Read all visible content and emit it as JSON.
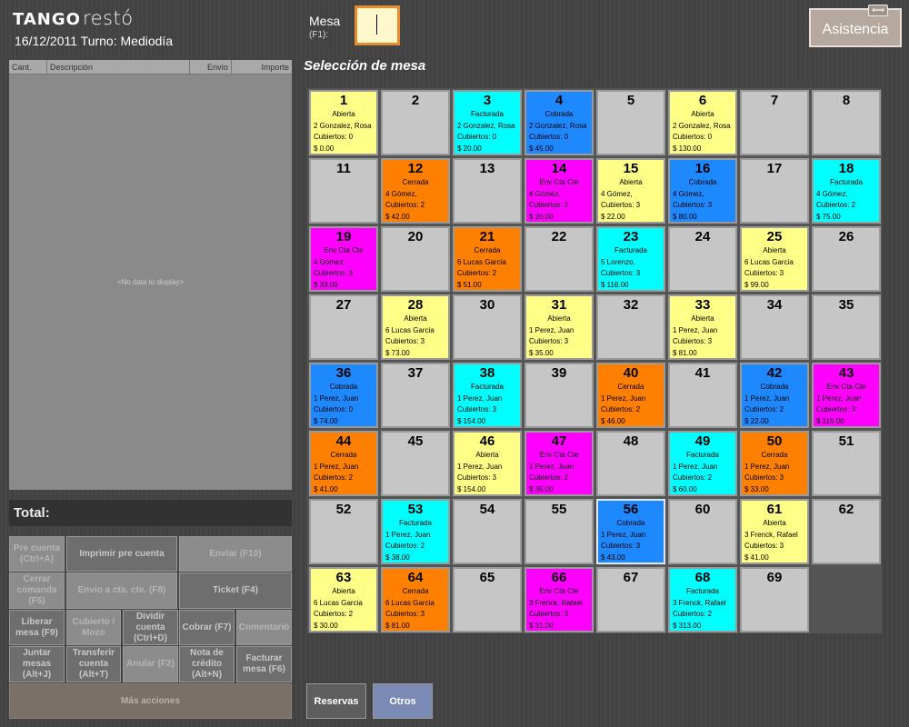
{
  "header": {
    "logo_main": "TANGO",
    "logo_sub": "restó",
    "date_turno": "16/12/2011 Turno: Mediodía",
    "mesa_label": "Mesa",
    "mesa_hint": "(F1):",
    "mesa_value": "",
    "asistencia_label": "Asistencia",
    "asistencia_badge": "⟺"
  },
  "order": {
    "columns": [
      "Cant.",
      "Descripción",
      "Envío",
      "Importe"
    ],
    "empty_text": "<No data to display>",
    "total_label": "Total:"
  },
  "actions": [
    {
      "label": "Pre cuenta (Ctrl+A)",
      "enabled": false
    },
    {
      "label": "Imprimir pre cuenta",
      "enabled": true
    },
    {
      "label": "Enviar (F10)",
      "enabled": false
    },
    {
      "label": "Cerrar comanda (F5)",
      "enabled": false
    },
    {
      "label": "Envío a cta. cte. (F8)",
      "enabled": false
    },
    {
      "label": "Ticket (F4)",
      "enabled": true
    },
    {
      "label": "Liberar mesa (F9)",
      "enabled": true
    },
    {
      "label": "Cubierto / Mozo",
      "enabled": false
    },
    {
      "label": "Dividir cuenta (Ctrl+D)",
      "enabled": true
    },
    {
      "label": "Cobrar (F7)",
      "enabled": true
    },
    {
      "label": "Comentario",
      "enabled": false
    },
    {
      "label": "Juntar mesas (Alt+J)",
      "enabled": true
    },
    {
      "label": "Transferir cuenta (Alt+T)",
      "enabled": true
    },
    {
      "label": "Anular (F2)",
      "enabled": false
    },
    {
      "label": "Nota de crédito (Alt+N)",
      "enabled": true
    },
    {
      "label": "Facturar mesa (F6)",
      "enabled": true
    },
    {
      "label": "Más acciones",
      "enabled": false
    }
  ],
  "section_title": "Selección de mesa",
  "status_colors": {
    "Abierta": "#ffff88",
    "Facturada": "#00ffff",
    "Cobrada": "#1e88ff",
    "Cerrada": "#ff8000",
    "Env Cta Cte": "#ff00ff",
    "Libre": "#c6c6c6"
  },
  "tables": [
    {
      "num": "1",
      "status": "Abierta",
      "client": "2 Gonzalez, Rosa",
      "cubiertos": "Cubiertos: 0",
      "amount": "$ 0.00"
    },
    {
      "num": "2"
    },
    {
      "num": "3",
      "status": "Facturada",
      "client": "2 Gonzalez, Rosa",
      "cubiertos": "Cubiertos: 0",
      "amount": "$ 20.00"
    },
    {
      "num": "4",
      "status": "Cobrada",
      "client": "2 Gonzalez, Rosa",
      "cubiertos": "Cubiertos: 0",
      "amount": "$ 45.00"
    },
    {
      "num": "5"
    },
    {
      "num": "6",
      "status": "Abierta",
      "client": "2 Gonzalez, Rosa",
      "cubiertos": "Cubiertos: 0",
      "amount": "$ 130.00"
    },
    {
      "num": "7"
    },
    {
      "num": "8"
    },
    {
      "num": "11"
    },
    {
      "num": "12",
      "status": "Cerrada",
      "client": "4 Gómez,",
      "cubiertos": "Cubiertos: 2",
      "amount": "$ 42.00"
    },
    {
      "num": "13"
    },
    {
      "num": "14",
      "status": "Env Cta Cte",
      "client": "4 Gómez,",
      "cubiertos": "Cubiertos: 2",
      "amount": "$ 20.00"
    },
    {
      "num": "15",
      "status": "Abierta",
      "client": "4 Gómez,",
      "cubiertos": "Cubiertos: 3",
      "amount": "$ 22.00"
    },
    {
      "num": "16",
      "status": "Cobrada",
      "client": "4 Gómez,",
      "cubiertos": "Cubiertos: 3",
      "amount": "$ 80.00"
    },
    {
      "num": "17"
    },
    {
      "num": "18",
      "status": "Facturada",
      "client": "4 Gómez,",
      "cubiertos": "Cubiertos: 2",
      "amount": "$ 75.00"
    },
    {
      "num": "19",
      "status": "Env Cta Cte",
      "client": "4 Gómez,",
      "cubiertos": "Cubiertos: 3",
      "amount": "$ 33.00"
    },
    {
      "num": "20"
    },
    {
      "num": "21",
      "status": "Cerrada",
      "client": "6 Lucas Garcia",
      "cubiertos": "Cubiertos: 2",
      "amount": "$ 51.00"
    },
    {
      "num": "22"
    },
    {
      "num": "23",
      "status": "Facturada",
      "client": "5 Lorenzo,",
      "cubiertos": "Cubiertos: 3",
      "amount": "$ 116.00"
    },
    {
      "num": "24"
    },
    {
      "num": "25",
      "status": "Abierta",
      "client": "6 Lucas Garcia",
      "cubiertos": "Cubiertos: 3",
      "amount": "$ 99.00"
    },
    {
      "num": "26"
    },
    {
      "num": "27"
    },
    {
      "num": "28",
      "status": "Abierta",
      "client": "6 Lucas Garcia",
      "cubiertos": "Cubiertos: 3",
      "amount": "$ 73.00"
    },
    {
      "num": "30"
    },
    {
      "num": "31",
      "status": "Abierta",
      "client": "1 Perez, Juan",
      "cubiertos": "Cubiertos: 3",
      "amount": "$ 35.00"
    },
    {
      "num": "32"
    },
    {
      "num": "33",
      "status": "Abierta",
      "client": "1 Perez, Juan",
      "cubiertos": "Cubiertos: 3",
      "amount": "$ 81.00"
    },
    {
      "num": "34"
    },
    {
      "num": "35"
    },
    {
      "num": "36",
      "status": "Cobrada",
      "client": "1 Perez, Juan",
      "cubiertos": "Cubiertos: 0",
      "amount": "$ 74.00"
    },
    {
      "num": "37"
    },
    {
      "num": "38",
      "status": "Facturada",
      "client": "1 Perez, Juan",
      "cubiertos": "Cubiertos: 3",
      "amount": "$ 154.00"
    },
    {
      "num": "39"
    },
    {
      "num": "40",
      "status": "Cerrada",
      "client": "1 Perez, Juan",
      "cubiertos": "Cubiertos: 2",
      "amount": "$ 46.00"
    },
    {
      "num": "41"
    },
    {
      "num": "42",
      "status": "Cobrada",
      "client": "1 Perez, Juan",
      "cubiertos": "Cubiertos: 2",
      "amount": "$ 22.00"
    },
    {
      "num": "43",
      "status": "Env Cta Cte",
      "client": "1 Perez, Juan",
      "cubiertos": "Cubiertos: 3",
      "amount": "$ 115.00"
    },
    {
      "num": "44",
      "status": "Cerrada",
      "client": "1 Perez, Juan",
      "cubiertos": "Cubiertos: 2",
      "amount": "$ 41.00"
    },
    {
      "num": "45"
    },
    {
      "num": "46",
      "status": "Abierta",
      "client": "1 Perez, Juan",
      "cubiertos": "Cubiertos: 3",
      "amount": "$ 154.00"
    },
    {
      "num": "47",
      "status": "Env Cta Cte",
      "client": "1 Perez, Juan",
      "cubiertos": "Cubiertos: 2",
      "amount": "$ 35.00"
    },
    {
      "num": "48"
    },
    {
      "num": "49",
      "status": "Facturada",
      "client": "1 Perez, Juan",
      "cubiertos": "Cubiertos: 2",
      "amount": "$ 60.00"
    },
    {
      "num": "50",
      "status": "Cerrada",
      "client": "1 Perez, Juan",
      "cubiertos": "Cubiertos: 3",
      "amount": "$ 33.00"
    },
    {
      "num": "51"
    },
    {
      "num": "52"
    },
    {
      "num": "53",
      "status": "Facturada",
      "client": "1 Perez, Juan",
      "cubiertos": "Cubiertos: 2",
      "amount": "$ 38.00"
    },
    {
      "num": "54"
    },
    {
      "num": "55"
    },
    {
      "num": "56",
      "status": "Cobrada",
      "client": "1 Perez, Juan",
      "cubiertos": "Cubiertos: 3",
      "amount": "$ 43.00",
      "selected": true
    },
    {
      "num": "60"
    },
    {
      "num": "61",
      "status": "Abierta",
      "client": "3 Frenck, Rafael",
      "cubiertos": "Cubiertos: 3",
      "amount": "$ 41.00"
    },
    {
      "num": "62"
    },
    {
      "num": "63",
      "status": "Abierta",
      "client": "6 Lucas Garcia",
      "cubiertos": "Cubiertos: 2",
      "amount": "$ 30.00"
    },
    {
      "num": "64",
      "status": "Cerrada",
      "client": "6 Lucas Garcia",
      "cubiertos": "Cubiertos: 3",
      "amount": "$ 81.00"
    },
    {
      "num": "65"
    },
    {
      "num": "66",
      "status": "Env Cta Cte",
      "client": "3 Frenck, Rafael",
      "cubiertos": "Cubiertos: 3",
      "amount": "$ 31.00"
    },
    {
      "num": "67"
    },
    {
      "num": "68",
      "status": "Facturada",
      "client": "3 Frenck, Rafael",
      "cubiertos": "Cubiertos: 2",
      "amount": "$ 313.00"
    },
    {
      "num": "69"
    }
  ],
  "bottom_tabs": [
    {
      "label": "Reservas",
      "bg": "#5e5e5e"
    },
    {
      "label": "Otros",
      "bg": "#7a8ab4"
    }
  ]
}
